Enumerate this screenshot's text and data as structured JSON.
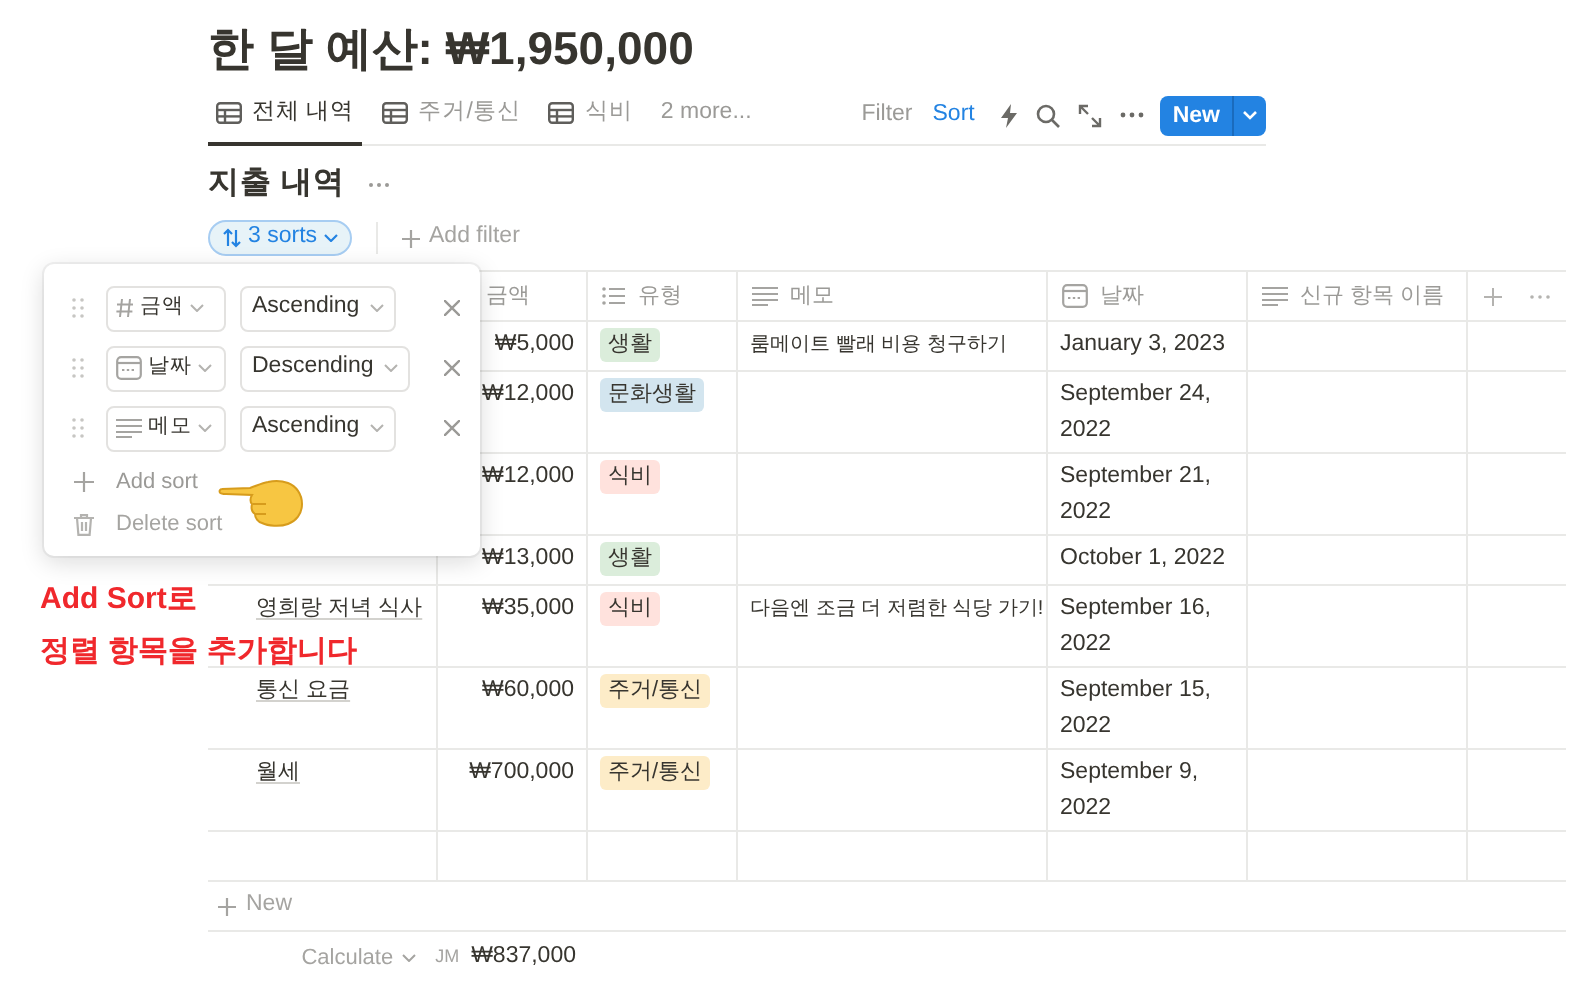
{
  "page_title": "한 달 예산: ₩1,950,000",
  "views": [
    {
      "label": "전체 내역",
      "kind": "table",
      "selected": true
    },
    {
      "label": "주거/통신",
      "kind": "table",
      "selected": false
    },
    {
      "label": "식비",
      "kind": "table",
      "selected": false
    },
    {
      "label": "2 more...",
      "kind": "more",
      "selected": false
    }
  ],
  "toolbar": [
    {
      "label": "Filter",
      "active": false
    },
    {
      "label": "Sort",
      "active": true
    }
  ],
  "new_button": "New",
  "database_title": "지출 내역",
  "sort_chip": "3 sorts",
  "add_filter": "Add filter",
  "columns": [
    {
      "label": "금액"
    },
    {
      "label": "유형",
      "kind": "select"
    },
    {
      "label": "메모",
      "kind": "text"
    },
    {
      "label": "날짜",
      "kind": "date"
    },
    {
      "label": "신규 항목 이름",
      "kind": "text"
    }
  ],
  "rows": [
    {
      "amount": "₩5,000",
      "tag": {
        "label": "생활",
        "color": "#dbeddb"
      },
      "memo": "룸메이트 빨래 비용 청구하기",
      "date": "January 3, 2023"
    },
    {
      "amount": "₩12,000",
      "tag": {
        "label": "문화생활",
        "color": "#d3e5ef"
      },
      "date": "September 24, 2022"
    },
    {
      "amount": "₩12,000",
      "tag": {
        "label": "식비",
        "color": "#ffe2dd"
      },
      "date": "September 21, 2022"
    },
    {
      "amount": "₩13,000",
      "tag": {
        "label": "생활",
        "color": "#dbeddb"
      },
      "date": "October 1, 2022"
    },
    {
      "name": "영희랑 저녁 식사",
      "amount": "₩35,000",
      "tag": {
        "label": "식비",
        "color": "#ffe2dd"
      },
      "memo": "다음엔 조금 더 저렴한 식당 가기!",
      "date": "September 16, 2022"
    },
    {
      "name": "통신 요금",
      "amount": "₩60,000",
      "tag": {
        "label": "주거/통신",
        "color": "#fdecc8"
      },
      "date": "September 15, 2022"
    },
    {
      "name": "월세",
      "amount": "₩700,000",
      "tag": {
        "label": "주거/통신",
        "color": "#fdecc8"
      },
      "date": "September 9, 2022"
    }
  ],
  "new_row": "New",
  "calculate": {
    "label": "Calculate",
    "aggregate": "JM",
    "total": "₩837,000"
  },
  "sort_menu": {
    "rules": [
      {
        "property": "금액",
        "kind": "number",
        "direction": "Ascending"
      },
      {
        "property": "날짜",
        "kind": "date",
        "direction": "Descending"
      },
      {
        "property": "메모",
        "kind": "text",
        "direction": "Ascending"
      }
    ],
    "add_sort": "Add sort",
    "delete_sort": "Delete sort"
  },
  "annotation": [
    "Add Sort로",
    "정렬 항목을 추가합니다"
  ]
}
